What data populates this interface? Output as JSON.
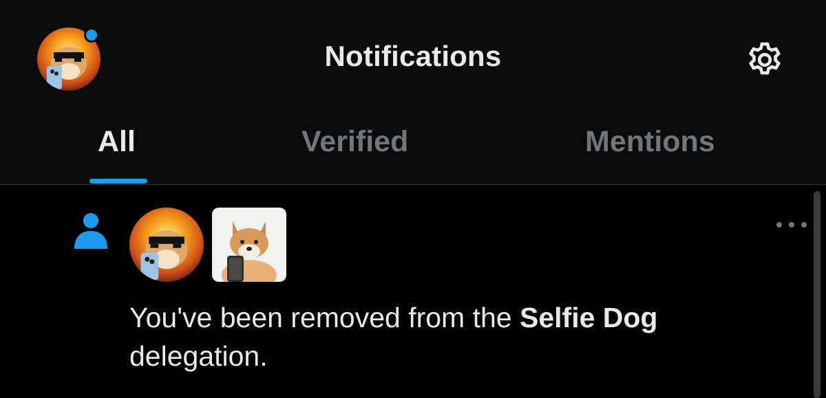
{
  "header": {
    "title": "Notifications",
    "profile_avatar_icon": "dog-with-sunglasses-avatar",
    "settings_icon": "gear-icon"
  },
  "tabs": [
    {
      "label": "All",
      "active": true
    },
    {
      "label": "Verified",
      "active": false
    },
    {
      "label": "Mentions",
      "active": false
    }
  ],
  "notification": {
    "type_icon": "person-icon",
    "text_prefix": "You've been removed from the ",
    "text_bold": "Selfie Dog",
    "text_suffix": "delegation.",
    "more_icon": "more-options-icon"
  },
  "colors": {
    "accent": "#1d9bf0",
    "background": "#000000",
    "header_background": "#0b0b0b",
    "text_primary": "#e7e9ea",
    "text_secondary": "#71767b"
  }
}
